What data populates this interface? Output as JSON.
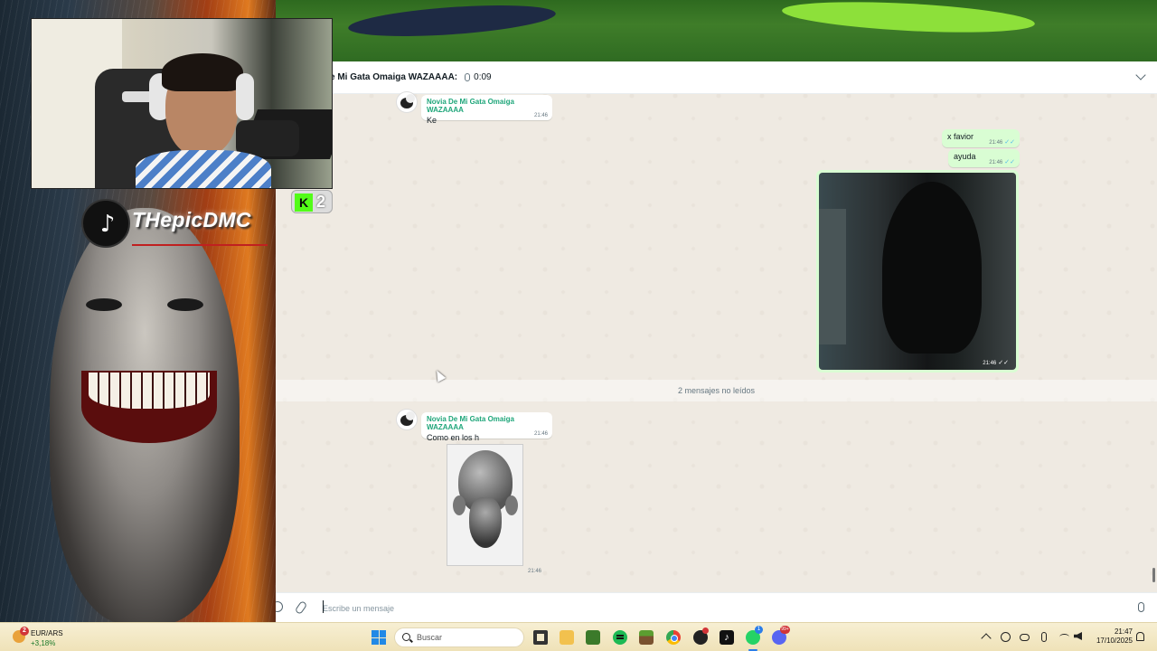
{
  "chat": {
    "header_name": "e Mi Gata Omaiga WAZAAAA:",
    "header_duration": "0:09",
    "messages": [
      {
        "sender": "Novia De Mi Gata Omaiga WAZAAAA",
        "text": "Ke",
        "time": "21:46",
        "direction": "incoming"
      },
      {
        "text": "x favior",
        "time": "21:46",
        "direction": "outgoing"
      },
      {
        "text": "ayuda",
        "time": "21:46",
        "direction": "outgoing"
      },
      {
        "type": "video",
        "time": "21:46",
        "direction": "outgoing"
      },
      {
        "sender": "Novia De Mi Gata Omaiga WAZAAAA",
        "text": "Como en los h",
        "time": "21:46",
        "direction": "incoming"
      },
      {
        "type": "image",
        "time": "21:46",
        "direction": "incoming"
      }
    ],
    "unread_divider": "2 mensajes no leídos",
    "composer_placeholder": "Escribe un mensaje",
    "accent_color": "#1fa67a",
    "outgoing_bubble_color": "#d9fdd3",
    "tick_color": "#53bdeb"
  },
  "overlay": {
    "tiktok_handle": "THepicDMC",
    "tiktok_icon": "♪",
    "kick_logo": "K",
    "kick_count": "2"
  },
  "taskbar": {
    "weather_badge": "2",
    "ticker_name": "EUR/ARS",
    "ticker_change": "+3,18%",
    "search_label": "Buscar",
    "whatsapp_badge": "1",
    "discord_badge": "99+",
    "clock_time": "21:47",
    "clock_date": "17/10/2025",
    "apps": [
      "task-view",
      "file-explorer",
      "minecraft",
      "spotify",
      "minecraft-grass",
      "chrome",
      "obs",
      "tiktok",
      "whatsapp",
      "discord"
    ]
  }
}
